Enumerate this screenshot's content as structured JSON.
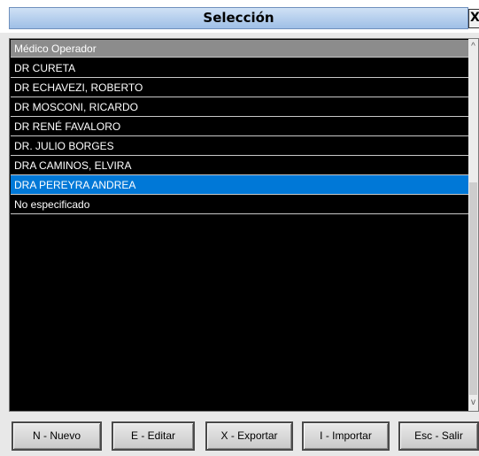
{
  "window": {
    "title": "Selección",
    "close_glyph": "X"
  },
  "list": {
    "header": "Médico Operador",
    "items": [
      {
        "label": "DR CURETA",
        "selected": false
      },
      {
        "label": "DR ECHAVEZI, ROBERTO",
        "selected": false
      },
      {
        "label": "DR MOSCONI, RICARDO",
        "selected": false
      },
      {
        "label": "DR RENÉ FAVALORO",
        "selected": false
      },
      {
        "label": "DR. JULIO BORGES",
        "selected": false
      },
      {
        "label": "DRA CAMINOS, ELVIRA",
        "selected": false
      },
      {
        "label": "DRA PEREYRA ANDREA",
        "selected": true
      },
      {
        "label": "No especificado",
        "selected": false
      }
    ]
  },
  "scrollbar": {
    "up_glyph": "^",
    "down_glyph": "v"
  },
  "buttons": {
    "nuevo": "N - Nuevo",
    "editar": "E - Editar",
    "exportar": "X - Exportar",
    "importar": "I - Importar",
    "salir": "Esc - Salir"
  },
  "colors": {
    "list_background": "#000000",
    "selection": "#0078d7",
    "header_background": "#8c8c8c"
  }
}
